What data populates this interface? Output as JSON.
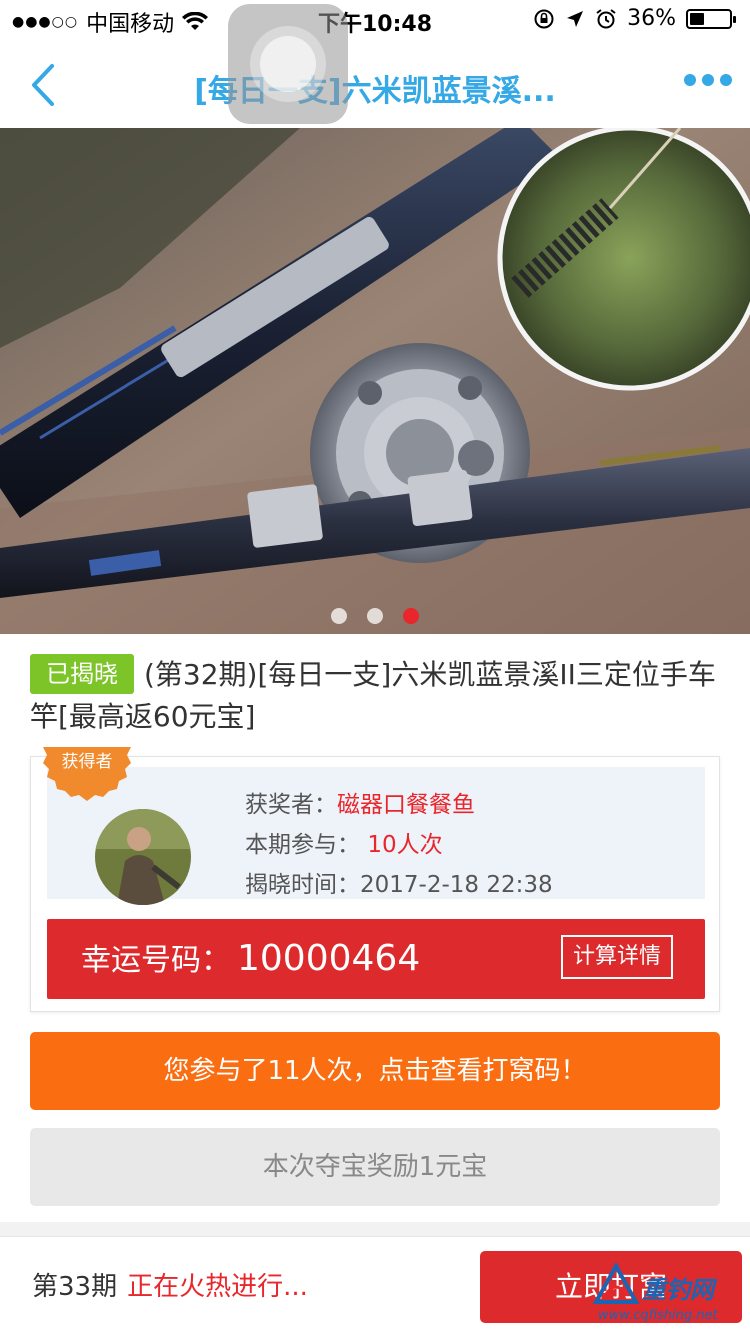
{
  "status_bar": {
    "carrier": "中国移动",
    "time": "下午10:48",
    "battery_percent": "36%",
    "battery_level": 0.36
  },
  "nav": {
    "title": "[每日一支]六米凯蓝景溪..."
  },
  "banner": {
    "page_count": 3,
    "active_page": 3
  },
  "product": {
    "status_tag": "已揭晓",
    "title": "(第32期)[每日一支]六米凯蓝景溪II三定位手车竿[最高返60元宝]"
  },
  "winner": {
    "badge": "获得者",
    "winner_label": "获奖者：",
    "winner_name": "磁器口餐餐鱼",
    "participation_label": "本期参与：",
    "participation_value": "10人次",
    "reveal_label": "揭晓时间：",
    "reveal_time": "2017-2-18 22:38",
    "lucky_label": "幸运号码：",
    "lucky_code": "10000464",
    "calc_button": "计算详情"
  },
  "actions": {
    "orange_button": "您参与了11人次，点击查看打窝码！",
    "grey_button": "本次夺宝奖励1元宝"
  },
  "bottom_bar": {
    "period": "第33期",
    "period_status": "正在火热进行...",
    "join_button": "立即打窝"
  },
  "watermark": {
    "brand": "重钓网",
    "url": "www.cqfishing.net"
  },
  "colors": {
    "accent_blue": "#35a8e6",
    "red": "#dd2a2c",
    "orange": "#fb6d11",
    "green_tag": "#7cc427"
  }
}
